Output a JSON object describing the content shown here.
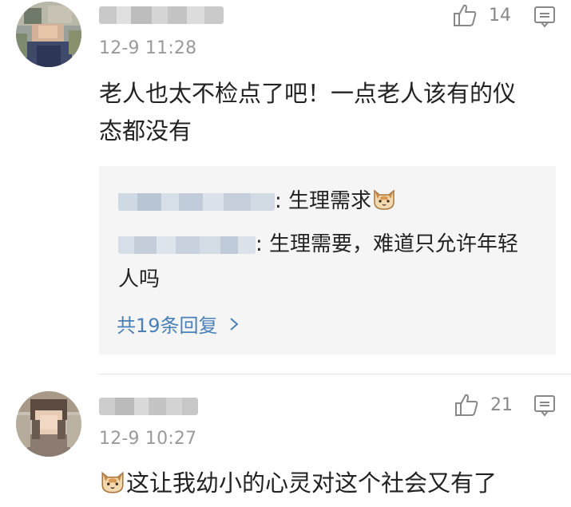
{
  "comments": [
    {
      "time": "12-9 11:28",
      "likes": "14",
      "text_line1": "老人也太不检点了吧！一点老人该有的仪",
      "text_line2": "态都没有",
      "replies": [
        {
          "text": ": 生理需求"
        },
        {
          "text": ": 生理需要，难道只允许年轻",
          "text_line2": "人吗"
        }
      ],
      "more_replies": "共19条回复"
    },
    {
      "time": "12-9 10:27",
      "likes": "21",
      "text_line1": "这让我幼小的心灵对这个社会又有了"
    }
  ],
  "icons": {
    "like": "thumbs-up-icon",
    "reply": "comment-icon",
    "emoji": "cat-face-emoji",
    "chevron": "chevron-right-icon"
  },
  "colors": {
    "link": "#4a7fb8",
    "meta": "#9a9a9a",
    "reply_bg": "#f5f5f5"
  }
}
